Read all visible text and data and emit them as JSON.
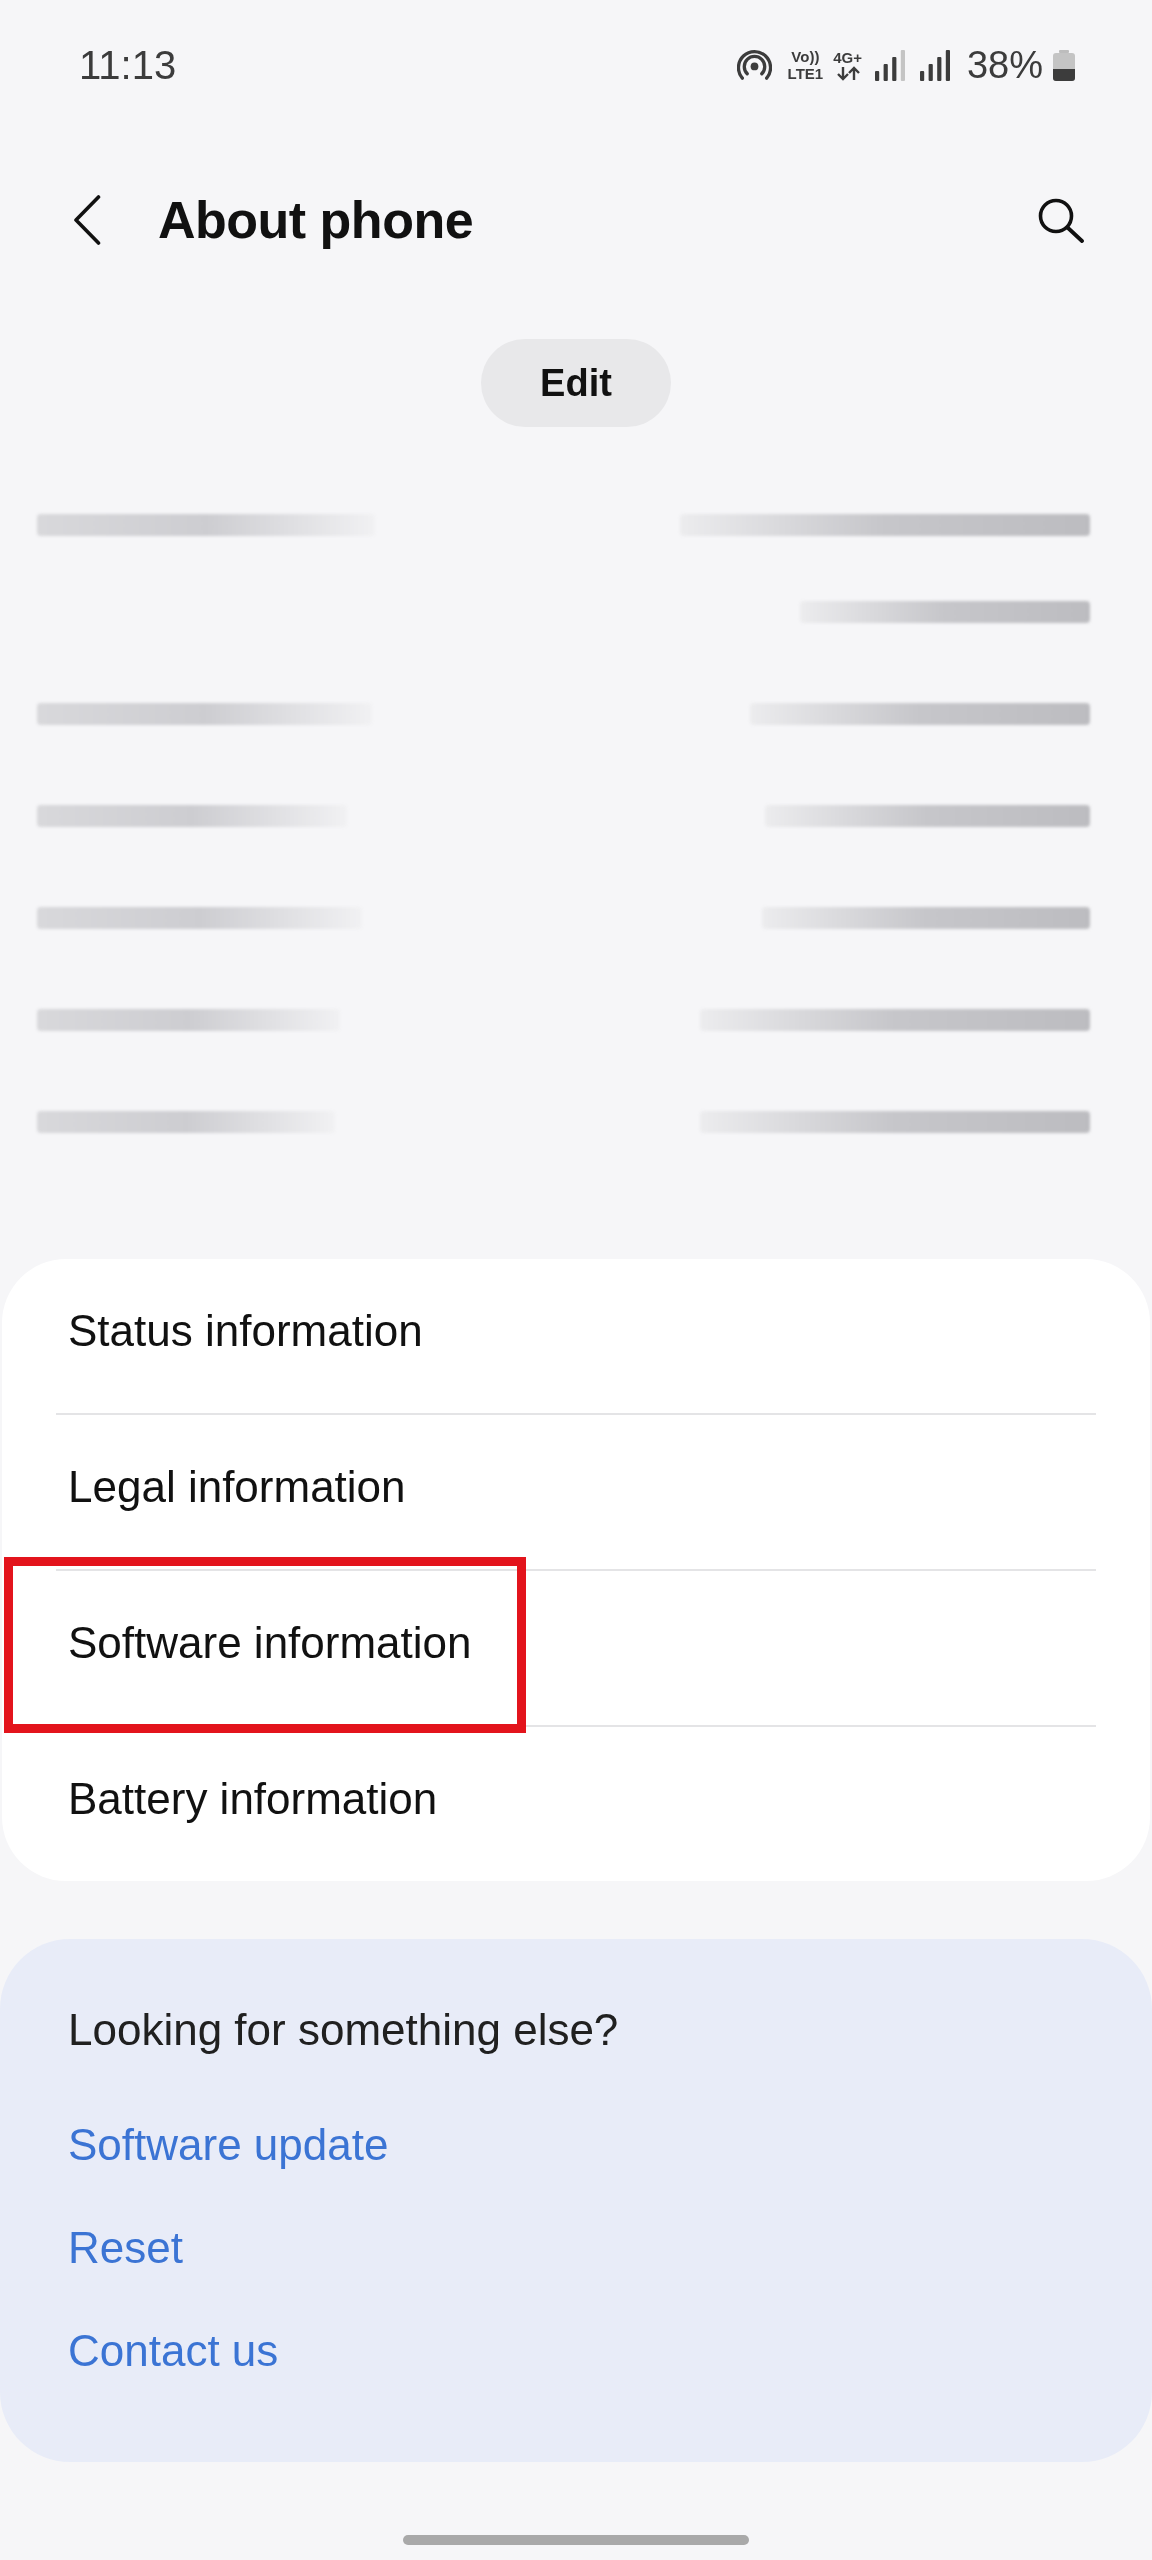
{
  "status_bar": {
    "time": "11:13",
    "volte": [
      "Vo))",
      "LTE1"
    ],
    "network": "4G+",
    "battery": "38%"
  },
  "header": {
    "title": "About phone"
  },
  "edit_button": {
    "label": "Edit"
  },
  "menu": [
    {
      "label": "Status information",
      "highlighted": false
    },
    {
      "label": "Legal information",
      "highlighted": false
    },
    {
      "label": "Software information",
      "highlighted": true
    },
    {
      "label": "Battery information",
      "highlighted": false
    }
  ],
  "suggestions": {
    "title": "Looking for something else?",
    "links": [
      "Software update",
      "Reset",
      "Contact us"
    ]
  }
}
